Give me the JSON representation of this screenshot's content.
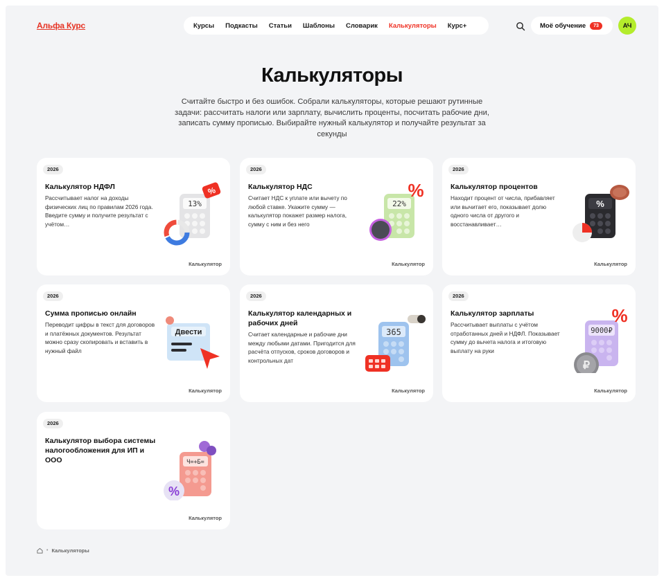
{
  "header": {
    "logo": "Альфа Курс",
    "nav": [
      "Курсы",
      "Подкасты",
      "Статьи",
      "Шаблоны",
      "Словарик",
      "Калькуляторы",
      "Курс+"
    ],
    "active_nav": "Калькуляторы",
    "my_learning": "Моё обучение",
    "my_learning_count": "73",
    "avatar_initials": "АЧ",
    "search_icon": "search-icon"
  },
  "hero": {
    "title": "Калькуляторы",
    "subtitle": "Считайте быстро и без ошибок. Собрали калькуляторы, которые решают рутинные задачи: рассчитать налоги или зарплату, вычислить проценты, посчитать рабочие дни, записать сумму прописью. Выбирайте нужный калькулятор и получайте результат за секунды"
  },
  "cards": [
    {
      "tag": "2026",
      "title": "Калькулятор НДФЛ",
      "desc": "Рассчитывает налог на доходы физических лиц по правилам 2026 года. Введите сумму и получите результат с учётом…",
      "type": "Калькулятор",
      "screen": "13%",
      "icon": "ndfl-calculator-illustration"
    },
    {
      "tag": "2026",
      "title": "Калькулятор НДС",
      "desc": "Считает НДС к уплате или вычету по любой ставке. Укажите сумму — калькулятор покажет размер налога, сумму с ним и без него",
      "type": "Калькулятор",
      "screen": "22%",
      "icon": "vat-calculator-illustration"
    },
    {
      "tag": "2026",
      "title": "Калькулятор процентов",
      "desc": "Находит процент от числа, прибавляет или вычитает его, показывает долю одного числа от другого и восстанавливает…",
      "type": "Калькулятор",
      "screen": "%",
      "icon": "percent-calculator-illustration"
    },
    {
      "tag": "2026",
      "title": "Сумма прописью онлайн",
      "desc": "Переводит цифры в текст для договоров и платёжных документов. Результат можно сразу скопировать и вставить в нужный файл",
      "type": "Калькулятор",
      "screen": "Двести",
      "icon": "amount-in-words-illustration"
    },
    {
      "tag": "2026",
      "title": "Калькулятор календарных и рабочих дней",
      "desc": "Считает календарные и рабочие дни между любыми датами. Пригодится для расчёта отпусков, сроков договоров и контрольных дат",
      "type": "Калькулятор",
      "screen": "365",
      "icon": "days-calculator-illustration"
    },
    {
      "tag": "2026",
      "title": "Калькулятор зарплаты",
      "desc": "Рассчитывает выплаты с учётом отработанных дней и НДФЛ. Показывает сумму до вычета налога и итоговую выплату на руки",
      "type": "Калькулятор",
      "screen": "9000₽",
      "icon": "salary-calculator-illustration"
    },
    {
      "tag": "2026",
      "title": "Калькулятор выбора системы налогообложения для ИП и ООО",
      "desc": "",
      "type": "Калькулятор",
      "screen": "Ч=+Б=",
      "icon": "tax-system-calculator-illustration"
    }
  ],
  "breadcrumb": {
    "home_icon": "home-icon",
    "current": "Калькуляторы"
  },
  "colors": {
    "accent": "#ef3124",
    "avatar": "#b4ec2c",
    "background": "#f3f4f6"
  }
}
